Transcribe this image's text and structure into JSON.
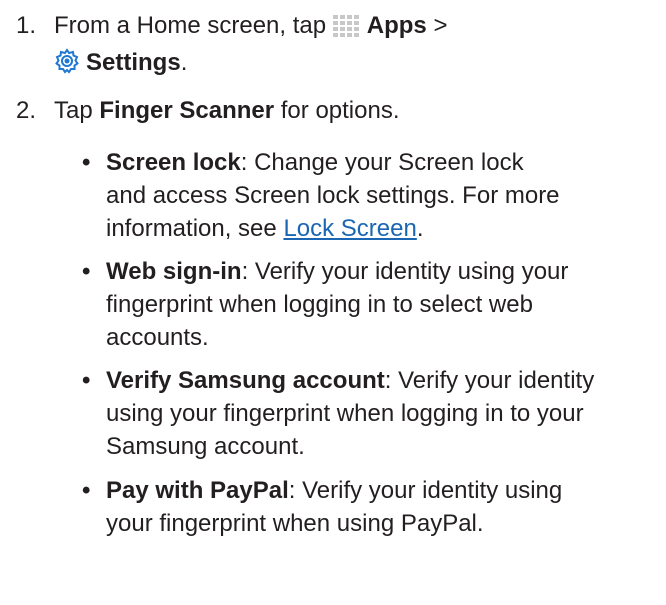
{
  "steps": [
    {
      "number": "1.",
      "prefix": "From a Home screen, tap",
      "apps_label": "Apps",
      "separator": ">",
      "settings_label": "Settings",
      "suffix": "."
    },
    {
      "number": "2.",
      "prefix": "Tap",
      "bold": "Finger Scanner",
      "suffix": "for options."
    }
  ],
  "options": [
    {
      "title": "Screen lock",
      "text_line1": ": Change your Screen lock",
      "text_line2": "and access Screen lock settings. For more",
      "text_line3_prefix": "information, see",
      "link": "Lock Screen",
      "text_line3_suffix": "."
    },
    {
      "title": "Web sign-in",
      "text_line1": ": Verify your identity using your",
      "text_line2": "fingerprint when logging in to select web",
      "text_line3": "accounts."
    },
    {
      "title": "Verify Samsung account",
      "text_line1": ": Verify your identity",
      "text_line2": "using your fingerprint when logging in to your",
      "text_line3": "Samsung account."
    },
    {
      "title": "Pay with PayPal",
      "text_line1": ": Verify your identity using",
      "text_line2": "your fingerprint when using PayPal."
    }
  ],
  "bullet_glyph": "•",
  "icons": {
    "apps": "apps-grid-icon",
    "settings": "settings-gear-icon"
  },
  "colors": {
    "text": "#231f20",
    "link": "#1a66b3",
    "apps_icon": "#c8c8c8",
    "settings_icon": "#1f78d1"
  }
}
